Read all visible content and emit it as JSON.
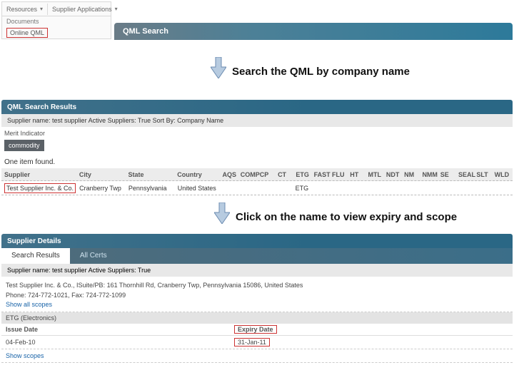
{
  "menu": {
    "resources": "Resources",
    "supplier_apps": "Supplier Applications",
    "documents": "Documents",
    "online_qml": "Online QML"
  },
  "header": {
    "title": "QML Search"
  },
  "callouts": {
    "c1": "Search the QML by company name",
    "c2": "Click on the name to view expiry and scope"
  },
  "results": {
    "title": "QML Search Results",
    "criteria": "Supplier name: test supplier   Active Suppliers: True  Sort By: Company Name",
    "merit_label": "Merit Indicator",
    "merit_chip": "commodity",
    "found": "One item found.",
    "cols": [
      "Supplier",
      "City",
      "State",
      "Country",
      "AQS",
      "COMP",
      "CP",
      "CT",
      "ETG",
      "FAST",
      "FLU",
      "HT",
      "MTL",
      "NDT",
      "NM",
      "NMM",
      "SE",
      "SEAL",
      "SLT",
      "WLD"
    ],
    "row": {
      "supplier": "Test Supplier Inc. & Co.",
      "city": "Cranberry Twp",
      "state": "Pennsylvania",
      "country": "United States",
      "etg": "ETG"
    }
  },
  "details": {
    "title": "Supplier Details",
    "tab_search": "Search Results",
    "tab_all": "All Certs",
    "criteria": "Supplier name: test supplier   Active Suppliers: True",
    "addr_line1": "Test Supplier Inc. & Co., ISuite/PB: 161 Thornhill Rd, Cranberry Twp, Pennsylvania 15086, United States",
    "addr_line2": "Phone: 724-772-1021, Fax: 724-772-1099",
    "show_all": "Show all scopes",
    "etg_label": "ETG (Electronics)",
    "issue_head": "Issue Date",
    "expiry_head": "Expiry Date",
    "issue_val": "04-Feb-10",
    "expiry_val": "31-Jan-11",
    "show_scopes": "Show scopes"
  }
}
